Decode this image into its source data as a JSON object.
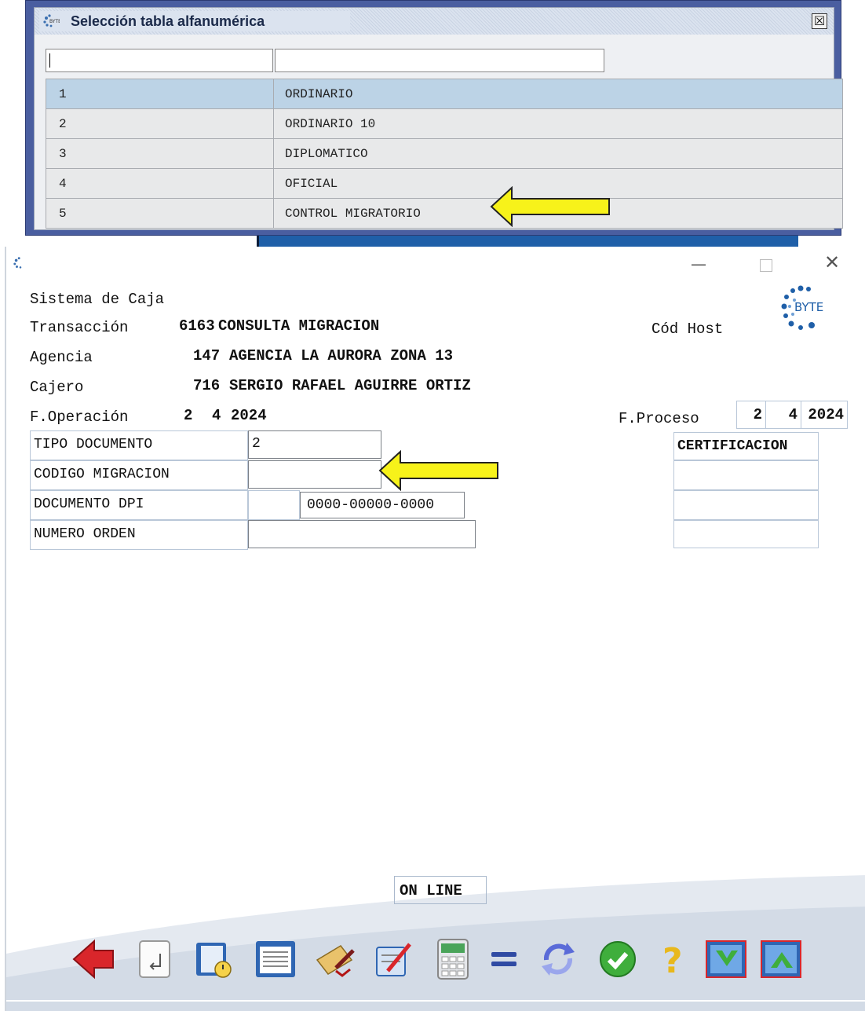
{
  "popup": {
    "title": "Selección tabla alfanumérica",
    "close_glyph": "☒",
    "filter1_value": "",
    "filter2_value": "",
    "rows": [
      {
        "code": "1",
        "desc": "ORDINARIO"
      },
      {
        "code": "2",
        "desc": "ORDINARIO 10"
      },
      {
        "code": "3",
        "desc": "DIPLOMATICO"
      },
      {
        "code": "4",
        "desc": "OFICIAL"
      },
      {
        "code": "5",
        "desc": "CONTROL MIGRATORIO"
      }
    ],
    "selected_row": 1
  },
  "window": {
    "min_glyph": "—",
    "close_glyph": "✕"
  },
  "header": {
    "system_label": "Sistema de Caja",
    "transaction_label": "Transacción",
    "transaction_code": "6163",
    "transaction_name": "CONSULTA MIGRACION",
    "cod_host_label": "Cód Host",
    "agency_label": "Agencia",
    "agency_code": "147",
    "agency_name": "AGENCIA LA AURORA ZONA 13",
    "cashier_label": "Cajero",
    "cashier_code": "716",
    "cashier_name": "SERGIO RAFAEL AGUIRRE ORTIZ",
    "op_date_label": "F.Operación",
    "op_day": "2",
    "op_month": "4",
    "op_year": "2024",
    "proc_date_label": "F.Proceso",
    "proc_day": "2",
    "proc_month": "4",
    "proc_year": "2024"
  },
  "form": {
    "tipo_documento_label": "TIPO DOCUMENTO",
    "tipo_documento_value": "2",
    "codigo_migracion_label": "CODIGO MIGRACION",
    "codigo_migracion_value": "",
    "documento_dpi_label": "DOCUMENTO DPI",
    "documento_dpi_value": "0000-00000-0000",
    "numero_orden_label": "NUMERO ORDEN",
    "numero_orden_value": "",
    "certificacion_label": "CERTIFICACION"
  },
  "status": {
    "online_label": "ON LINE"
  },
  "brand": {
    "logo_text": "BYTE",
    "accent": "#1f5fa8",
    "arrow_color": "#f7f21a"
  },
  "toolbar": {
    "icons": [
      "back-arrow-icon",
      "enter-icon",
      "agenda-icon",
      "document-list-icon",
      "signature-pen-icon",
      "edit-pencil-icon",
      "calculator-icon",
      "equals-icon",
      "refresh-icon",
      "check-icon",
      "help-icon",
      "data-in-icon",
      "data-out-icon"
    ]
  }
}
